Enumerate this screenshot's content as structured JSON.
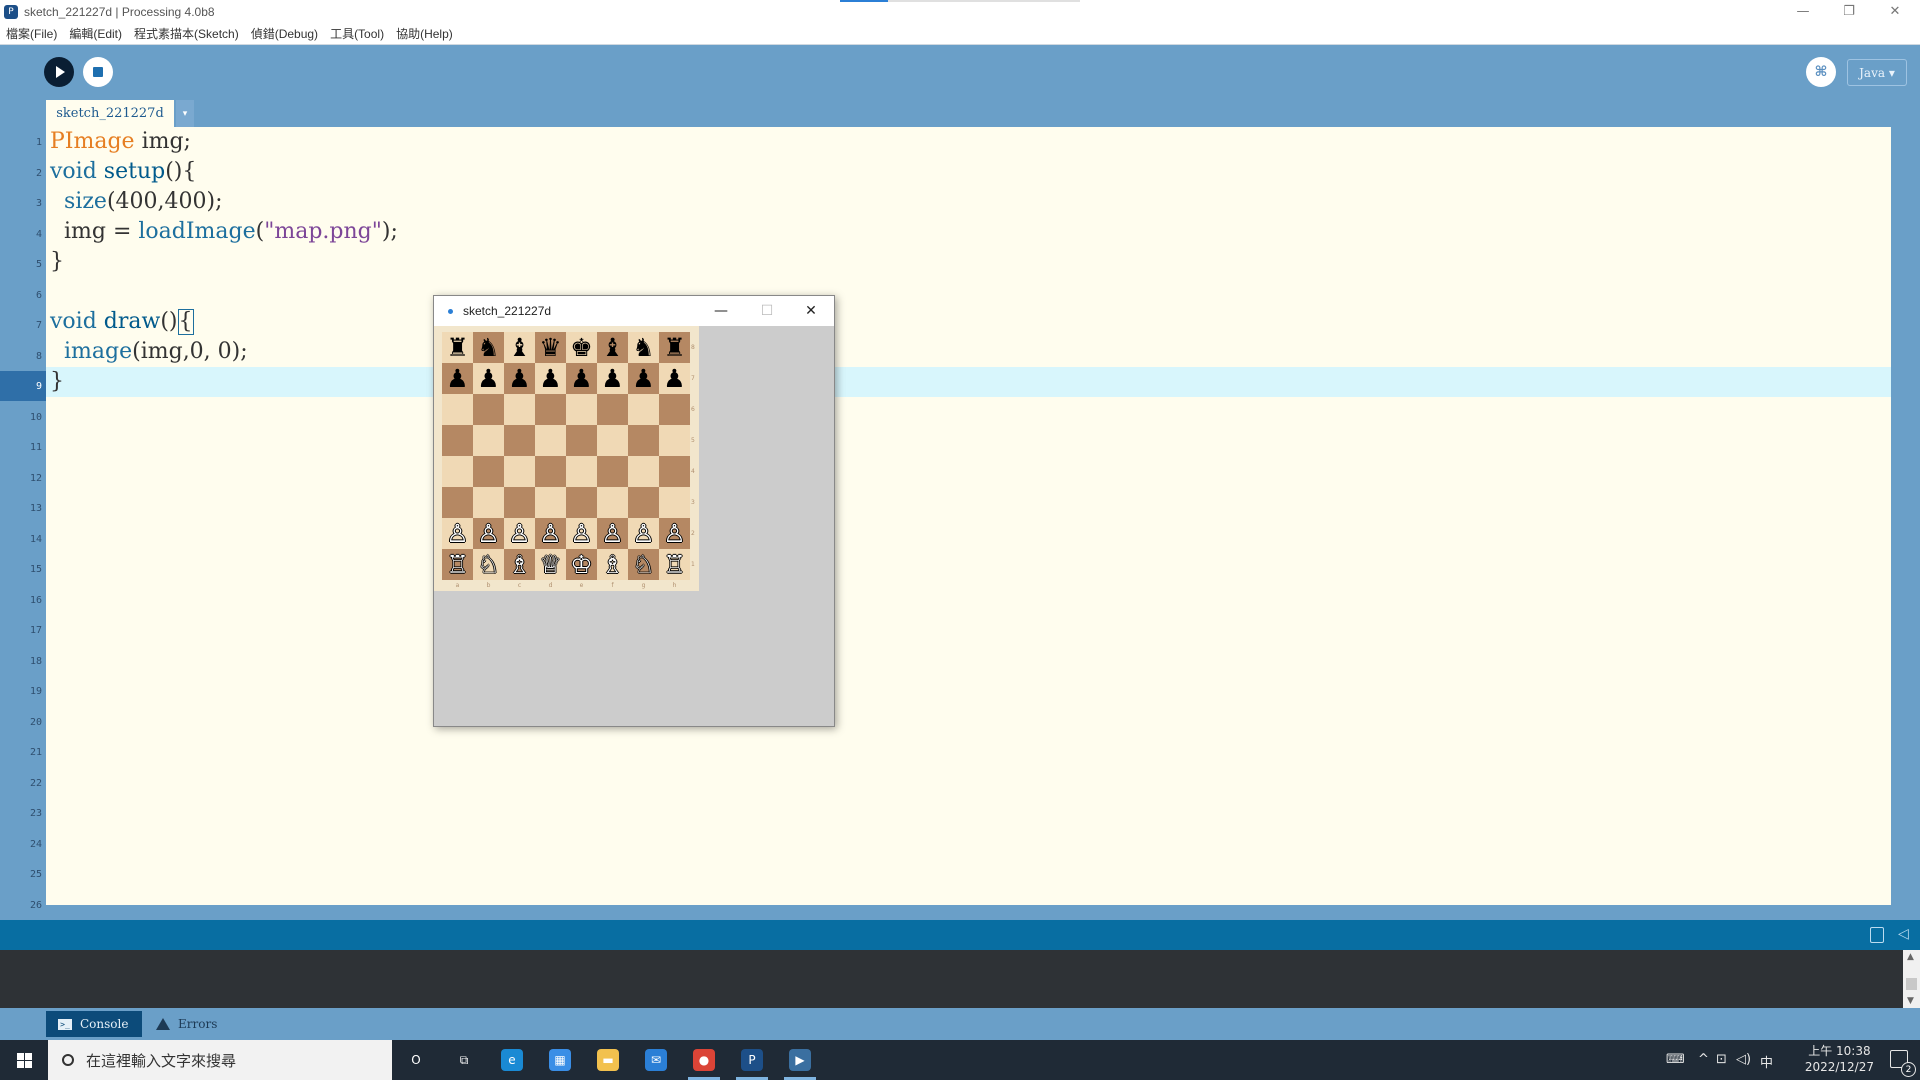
{
  "window": {
    "title": "sketch_221227d | Processing 4.0b8",
    "app_icon_label": "P"
  },
  "menu": [
    "檔案(File)",
    "編輯(Edit)",
    "程式素描本(Sketch)",
    "偵錯(Debug)",
    "工具(Tool)",
    "協助(Help)"
  ],
  "toolbar": {
    "run_icon": "play-icon",
    "stop_icon": "stop-icon",
    "debug_icon": "debugger-icon",
    "debug_label": "⌘",
    "mode": "Java ▾"
  },
  "tabs": {
    "active": "sketch_221227d",
    "menu_arrow": "▾"
  },
  "editor": {
    "line_numbers": [
      "1",
      "2",
      "3",
      "4",
      "5",
      "6",
      "7",
      "8",
      "9",
      "10",
      "11",
      "12",
      "13",
      "14",
      "15",
      "16",
      "17",
      "18",
      "19",
      "20",
      "21",
      "22",
      "23",
      "24",
      "25",
      "26"
    ],
    "current_line": 9,
    "lines": [
      "PImage img;",
      "void setup(){",
      "  size(400,400);",
      "  img = loadImage(\"map.png\");",
      "}",
      "",
      "void draw(){",
      "  image(img,0, 0);",
      "}"
    ]
  },
  "console_tabs": {
    "console": "Console",
    "errors": "Errors",
    "console_icon": ">_"
  },
  "taskbar": {
    "search_placeholder": "在這裡輸入文字來搜尋",
    "apps": [
      {
        "name": "cortana-icon",
        "label": "O",
        "color": "transparent"
      },
      {
        "name": "task-view-icon",
        "label": "⧉",
        "color": "transparent"
      },
      {
        "name": "edge-icon",
        "label": "e",
        "color": "#1a8ad4"
      },
      {
        "name": "store-icon",
        "label": "▦",
        "color": "#3a8ee6"
      },
      {
        "name": "file-explorer-icon",
        "label": "▬",
        "color": "#f2c14e"
      },
      {
        "name": "mail-icon",
        "label": "✉",
        "color": "#2b7fd6"
      },
      {
        "name": "chrome-icon",
        "label": "●",
        "color": "#db4437"
      },
      {
        "name": "processing-icon",
        "label": "P",
        "color": "#1d4f88"
      },
      {
        "name": "sketch-app-icon",
        "label": "▶",
        "color": "#3a6fa0"
      }
    ],
    "tray": {
      "keyboard_icon": "⌨",
      "up_arrow": "^",
      "network_icon": "⊡",
      "volume_icon": "◁)",
      "ime": "中"
    },
    "clock": {
      "time": "上午 10:38",
      "date": "2022/12/27"
    },
    "notification_count": "2"
  },
  "sketch_window": {
    "title": "sketch_221227d",
    "minimize": "—",
    "maximize": "☐",
    "close": "✕",
    "board": [
      [
        "♜",
        "♞",
        "♝",
        "♛",
        "♚",
        "♝",
        "♞",
        "♜"
      ],
      [
        "♟",
        "♟",
        "♟",
        "♟",
        "♟",
        "♟",
        "♟",
        "♟"
      ],
      [
        "",
        "",
        "",
        "",
        "",
        "",
        "",
        ""
      ],
      [
        "",
        "",
        "",
        "",
        "",
        "",
        "",
        ""
      ],
      [
        "",
        "",
        "",
        "",
        "",
        "",
        "",
        ""
      ],
      [
        "",
        "",
        "",
        "",
        "",
        "",
        "",
        ""
      ],
      [
        "♙",
        "♙",
        "♙",
        "♙",
        "♙",
        "♙",
        "♙",
        "♙"
      ],
      [
        "♖",
        "♘",
        "♗",
        "♕",
        "♔",
        "♗",
        "♘",
        "♖"
      ]
    ],
    "ranks": [
      "8",
      "7",
      "6",
      "5",
      "4",
      "3",
      "2",
      "1"
    ],
    "files": [
      "a",
      "b",
      "c",
      "d",
      "e",
      "f",
      "g",
      "h"
    ],
    "colors": {
      "light": "#f0d9b5",
      "dark": "#b58863"
    }
  }
}
